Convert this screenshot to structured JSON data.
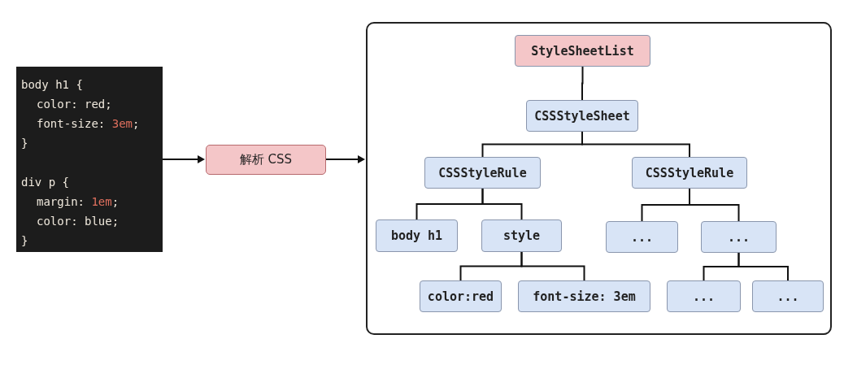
{
  "code_panel": {
    "lines": [
      {
        "kind": "code",
        "indent": false,
        "segments": [
          {
            "text": "body h1 {",
            "kind": "plain"
          }
        ]
      },
      {
        "kind": "code",
        "indent": true,
        "segments": [
          {
            "text": "color: red;",
            "kind": "plain"
          }
        ]
      },
      {
        "kind": "code",
        "indent": true,
        "segments": [
          {
            "text": "font-size: ",
            "kind": "plain"
          },
          {
            "text": "3em",
            "kind": "number"
          },
          {
            "text": ";",
            "kind": "plain"
          }
        ]
      },
      {
        "kind": "code",
        "indent": false,
        "segments": [
          {
            "text": "}",
            "kind": "plain"
          }
        ]
      },
      {
        "kind": "blank"
      },
      {
        "kind": "code",
        "indent": false,
        "segments": [
          {
            "text": "div p {",
            "kind": "plain"
          }
        ]
      },
      {
        "kind": "code",
        "indent": true,
        "segments": [
          {
            "text": "margin: ",
            "kind": "plain"
          },
          {
            "text": "1em",
            "kind": "number"
          },
          {
            "text": ";",
            "kind": "plain"
          }
        ]
      },
      {
        "kind": "code",
        "indent": true,
        "segments": [
          {
            "text": "color: blue;",
            "kind": "plain"
          }
        ]
      },
      {
        "kind": "code",
        "indent": false,
        "segments": [
          {
            "text": "}",
            "kind": "plain"
          }
        ]
      }
    ]
  },
  "parse_step": {
    "label": "解析 CSS"
  },
  "tree": [
    {
      "label": "StyleSheetList",
      "color": "#f4c6c8",
      "children": [
        {
          "label": "CSSStyleSheet",
          "color": "#d8e4f6",
          "children": [
            {
              "label": "CSSStyleRule",
              "color": "#d8e4f6",
              "children": [
                {
                  "label": "body h1",
                  "color": "#d8e4f6"
                },
                {
                  "label": "style",
                  "color": "#d8e4f6",
                  "children": [
                    {
                      "label": "color:red",
                      "color": "#d8e4f6"
                    },
                    {
                      "label": "font-size: 3em",
                      "color": "#d8e4f6"
                    }
                  ]
                }
              ]
            },
            {
              "label": "CSSStyleRule",
              "color": "#d8e4f6",
              "children": [
                {
                  "label": "...",
                  "color": "#d8e4f6"
                },
                {
                  "label": "...",
                  "color": "#d8e4f6",
                  "children": [
                    {
                      "label": "...",
                      "color": "#d8e4f6"
                    },
                    {
                      "label": "...",
                      "color": "#d8e4f6"
                    }
                  ]
                }
              ]
            }
          ]
        }
      ]
    }
  ]
}
